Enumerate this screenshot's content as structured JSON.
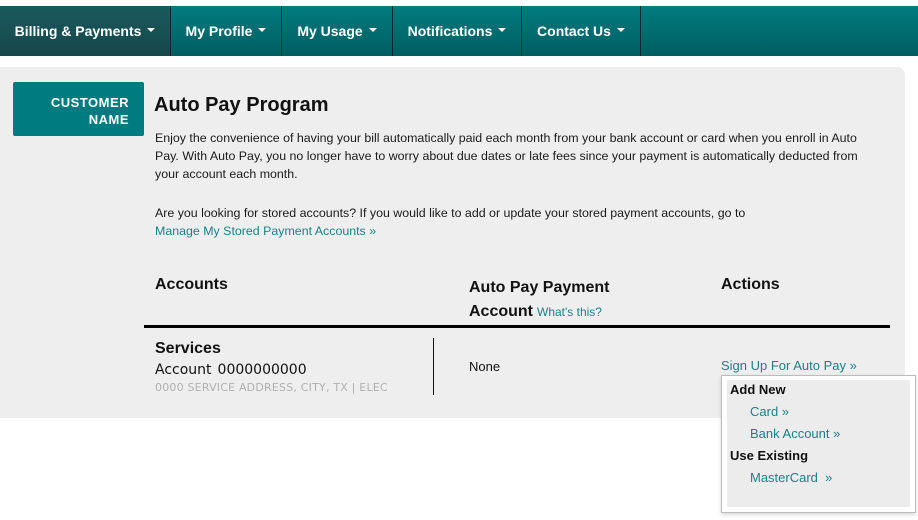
{
  "nav": {
    "items": [
      {
        "label": "Billing & Payments",
        "active": true
      },
      {
        "label": "My Profile",
        "active": false
      },
      {
        "label": "My Usage",
        "active": false
      },
      {
        "label": "Notifications",
        "active": false
      },
      {
        "label": "Contact Us",
        "active": false
      }
    ]
  },
  "customer": {
    "line1": "CUSTOMER",
    "line2": "NAME"
  },
  "page": {
    "title": "Auto Pay Program",
    "intro": "Enjoy the convenience of having your bill automatically paid each month from your bank account or card when you enroll in Auto Pay. With Auto Pay, you no longer have to worry about due dates or late fees since your payment is automatically deducted from your account each month.",
    "stored_text": "Are you looking for stored accounts? If you would like to add or update your stored payment accounts, go to",
    "stored_link": "Manage My Stored Payment Accounts »"
  },
  "table": {
    "headers": {
      "accounts": "Accounts",
      "autopay_line1": "Auto Pay Payment",
      "autopay_line2": "Account",
      "whats_this": "What's this?",
      "actions": "Actions"
    },
    "rows": [
      {
        "title": "Services",
        "account_label": "Account",
        "account_number": "0000000000",
        "address": "0000 SERVICE ADDRESS, CITY, TX | ELEC",
        "autopay_account": "None",
        "action": "Sign Up For Auto Pay »"
      }
    ]
  },
  "dropdown": {
    "add_new_heading": "Add New",
    "add_new_items": [
      "Card »",
      "Bank Account »"
    ],
    "use_existing_heading": "Use Existing",
    "use_existing_items": [
      "MasterCard  »"
    ]
  },
  "colors": {
    "nav_teal": "#037c80",
    "nav_active": "#1a5a5e",
    "link": "#1a8188",
    "panel": "#eeeeee"
  }
}
